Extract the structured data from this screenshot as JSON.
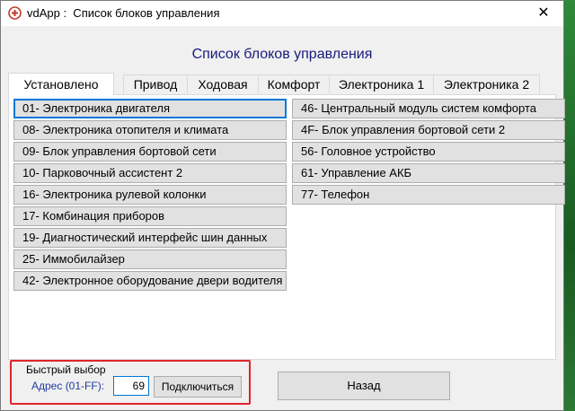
{
  "window": {
    "title": "vdApp :  Список блоков управления",
    "close_glyph": "✕"
  },
  "heading": "Список блоков управления",
  "tabs": [
    {
      "label": "Установлено"
    },
    {
      "label": "Привод"
    },
    {
      "label": "Ходовая"
    },
    {
      "label": "Комфорт"
    },
    {
      "label": "Электроника 1"
    },
    {
      "label": "Электроника 2"
    }
  ],
  "modules_left": [
    {
      "label": "01- Электроника двигателя"
    },
    {
      "label": "08- Электроника отопителя и климата"
    },
    {
      "label": "09- Блок управления бортовой сети"
    },
    {
      "label": "10- Парковочный ассистент 2"
    },
    {
      "label": "16- Электроника рулевой колонки"
    },
    {
      "label": "17- Комбинация приборов"
    },
    {
      "label": "19- Диагностический интерфейс шин данных"
    },
    {
      "label": "25- Иммобилайзер"
    },
    {
      "label": "42- Электронное оборудование двери водителя"
    }
  ],
  "modules_right": [
    {
      "label": "46- Центральный модуль систем комфорта"
    },
    {
      "label": "4F- Блок управления бортовой сети 2"
    },
    {
      "label": "56- Головное устройство"
    },
    {
      "label": "61- Управление АКБ"
    },
    {
      "label": "77- Телефон"
    }
  ],
  "quick_select": {
    "label": "Быстрый выбор",
    "address_label": "Адрес (01-FF):",
    "address_value": "69",
    "connect_label": "Подключиться"
  },
  "back_label": "Назад",
  "colors": {
    "heading": "#1a1a7c",
    "highlight": "#e0242a",
    "focus": "#0078d7",
    "button": "#e1e1e1"
  }
}
